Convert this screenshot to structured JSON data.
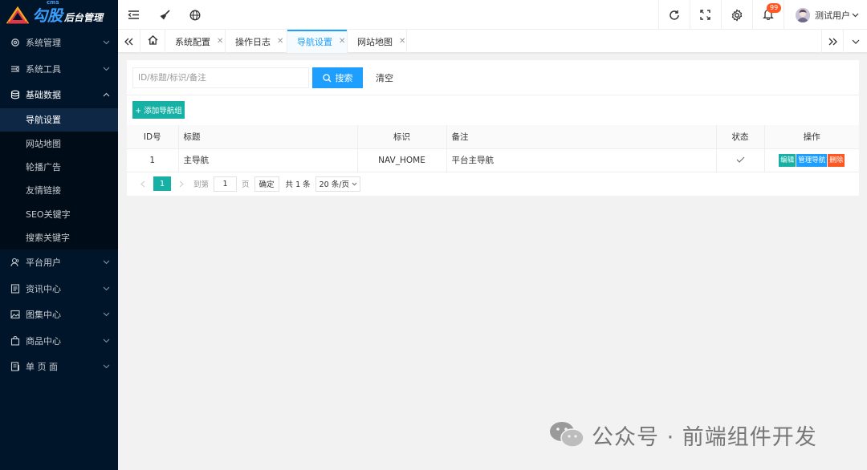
{
  "brand": {
    "logo_tiny": "cms",
    "logo_main": "勾股",
    "logo_sub": "后台管理"
  },
  "sidebar": {
    "items": [
      {
        "label": "系统管理",
        "icon": "gear-icon"
      },
      {
        "label": "系统工具",
        "icon": "tools-icon"
      },
      {
        "label": "基础数据",
        "icon": "database-icon",
        "expanded": true,
        "children": [
          {
            "label": "导航设置",
            "active": true
          },
          {
            "label": "网站地图"
          },
          {
            "label": "轮播广告"
          },
          {
            "label": "友情链接"
          },
          {
            "label": "SEO关键字"
          },
          {
            "label": "搜索关键字"
          }
        ]
      },
      {
        "label": "平台用户",
        "icon": "users-icon"
      },
      {
        "label": "资讯中心",
        "icon": "document-icon"
      },
      {
        "label": "图集中心",
        "icon": "image-icon"
      },
      {
        "label": "商品中心",
        "icon": "shopping-bag-icon"
      },
      {
        "label": "单 页 面",
        "icon": "page-icon"
      }
    ]
  },
  "topbar": {
    "icons": [
      "menu-collapse-icon",
      "broom-icon",
      "globe-icon",
      "refresh-icon",
      "fullscreen-icon",
      "settings-icon",
      "bell-icon"
    ],
    "notification_count": "99",
    "user_name": "测试用户"
  },
  "tabs": [
    {
      "label": "系统配置",
      "closable": true
    },
    {
      "label": "操作日志",
      "closable": true
    },
    {
      "label": "导航设置",
      "closable": true,
      "active": true
    },
    {
      "label": "网站地图",
      "closable": true
    }
  ],
  "toolbar": {
    "search_placeholder": "ID/标题/标识/备注",
    "search_label": "搜索",
    "clear_label": "清空",
    "add_label": "+ 添加导航组"
  },
  "table": {
    "headers": [
      "ID号",
      "标题",
      "标识",
      "备注",
      "状态",
      "操作"
    ],
    "rows": [
      {
        "id": "1",
        "title": "主导航",
        "key": "NAV_HOME",
        "remark": "平台主导航",
        "status_icon": "check-icon",
        "actions": [
          "编辑",
          "管理导航",
          "删除"
        ]
      }
    ]
  },
  "pagination": {
    "current": "1",
    "goto_prefix": "到第",
    "goto_value": "1",
    "goto_suffix": "页",
    "confirm": "确定",
    "total": "共 1 条",
    "page_size": "20 条/页"
  },
  "watermark": {
    "text": "公众号 · 前端组件开发"
  },
  "colors": {
    "sidebar": "#001529",
    "primary": "#1e9fff",
    "teal": "#16b1a4",
    "danger": "#ff5722"
  }
}
